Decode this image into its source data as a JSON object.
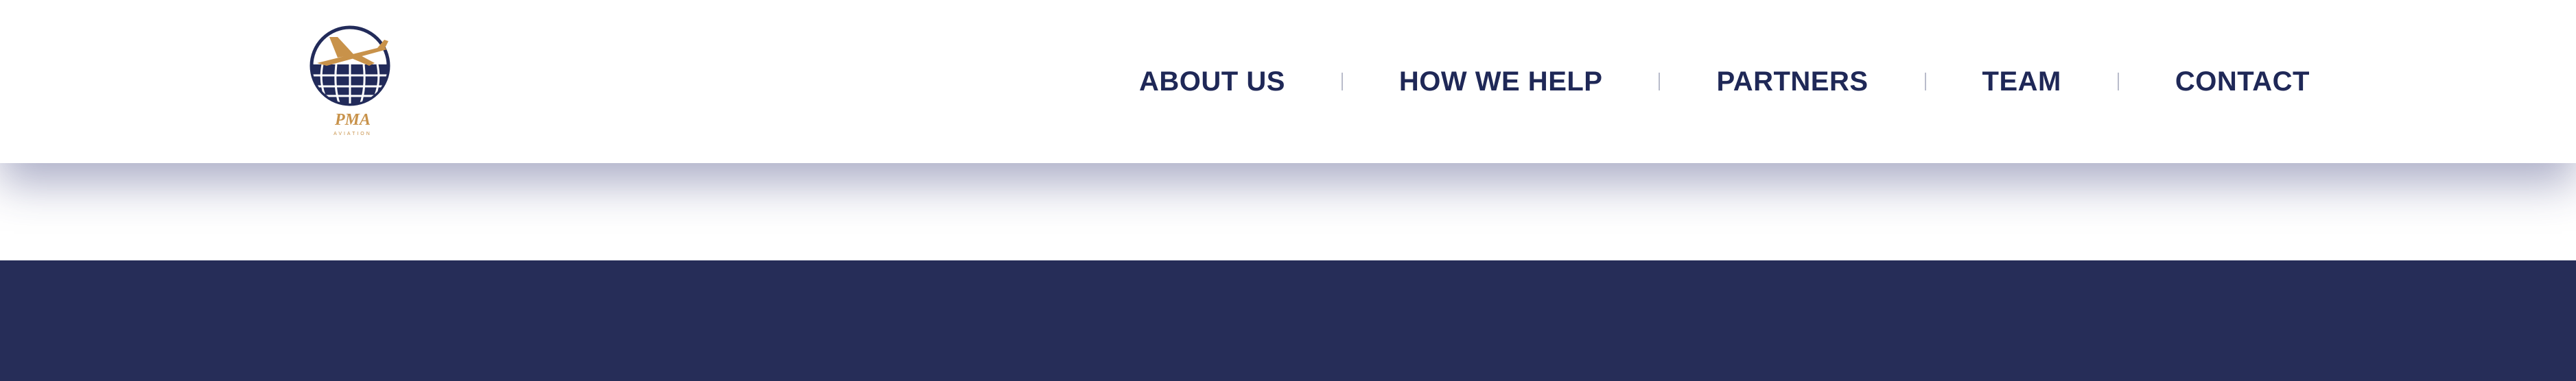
{
  "brand": {
    "logo_text": "PMA",
    "logo_subtext": "AVIATION",
    "icon": "airplane-globe-logo-icon",
    "colors": {
      "navy": "#222b5a",
      "gold": "#c8924a"
    }
  },
  "nav": {
    "items": [
      {
        "label": "ABOUT US"
      },
      {
        "label": "HOW WE HELP"
      },
      {
        "label": "PARTNERS"
      },
      {
        "label": "TEAM"
      },
      {
        "label": "CONTACT"
      }
    ]
  },
  "colors": {
    "nav_text": "#1f2857",
    "separator": "#b9bccb",
    "band": "#262d58",
    "background": "#ffffff"
  }
}
